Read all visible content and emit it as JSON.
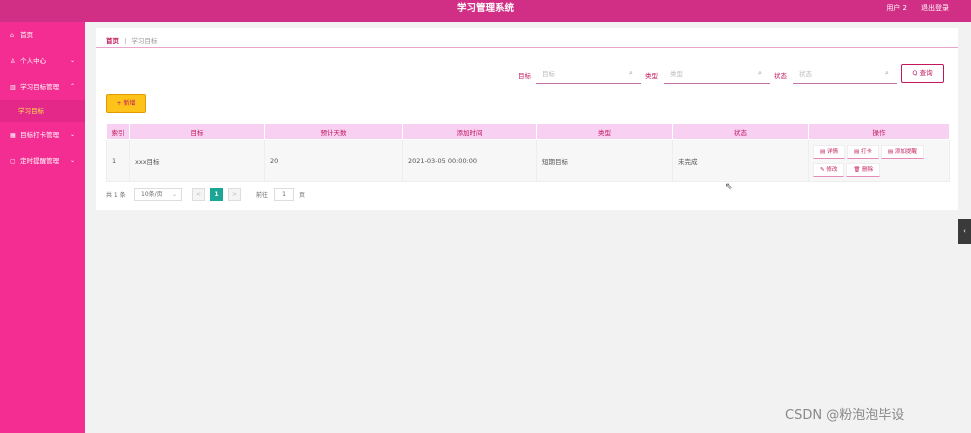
{
  "header": {
    "title": "学习管理系统",
    "user": "用户 2",
    "logout": "退出登录"
  },
  "sidebar": {
    "items": [
      {
        "label": "首页",
        "icon": "home-icon",
        "glyph": "⌂",
        "arrow": ""
      },
      {
        "label": "个人中心",
        "icon": "user-icon",
        "glyph": "♙",
        "arrow": "⌄"
      },
      {
        "label": "学习目标管理",
        "icon": "chart-icon",
        "glyph": "▥",
        "arrow": "⌃"
      },
      {
        "label": "目标打卡管理",
        "icon": "grid-icon",
        "glyph": "▦",
        "arrow": "⌄"
      },
      {
        "label": "定时提醒管理",
        "icon": "chat-icon",
        "glyph": "▢",
        "arrow": "⌄"
      }
    ],
    "submenu": {
      "label": "学习目标"
    }
  },
  "breadcrumb": {
    "home": "首页",
    "sep": "|",
    "current": "学习目标"
  },
  "filters": {
    "goal": {
      "label": "目标",
      "placeholder": "目标"
    },
    "type": {
      "label": "类型",
      "placeholder": "类型"
    },
    "status": {
      "label": "状态",
      "placeholder": "状态"
    },
    "query": "Q 查询"
  },
  "add_button": "+ 新增",
  "table": {
    "headers": [
      "索引",
      "目标",
      "预计天数",
      "添加时间",
      "类型",
      "状态",
      "操作"
    ],
    "rows": [
      {
        "index": "1",
        "goal": "xxx目标",
        "days": "20",
        "time": "2021-03-05 00:00:00",
        "type": "短期目标",
        "status": "未完成"
      }
    ],
    "actions": [
      "▤ 详情",
      "▤ 打卡",
      "▤ 添加提醒",
      "✎ 修改",
      "🗑 删除"
    ]
  },
  "pagination": {
    "total": "共 1 条",
    "page_size": "10条/页",
    "page_size_arrow": "⌄",
    "prev": "<",
    "current": "1",
    "next": ">",
    "goto": "前往",
    "goto_value": "1",
    "page_unit": "页"
  },
  "side_tab": "‹",
  "watermark": "CSDN @粉泡泡毕设",
  "colors": {
    "topbar": "#d02f85",
    "sidebar": "#f32d92",
    "accent": "#c2185b",
    "add_button": "#fdc31a",
    "table_header": "#f7d0f2",
    "active_page": "#1aa594"
  }
}
